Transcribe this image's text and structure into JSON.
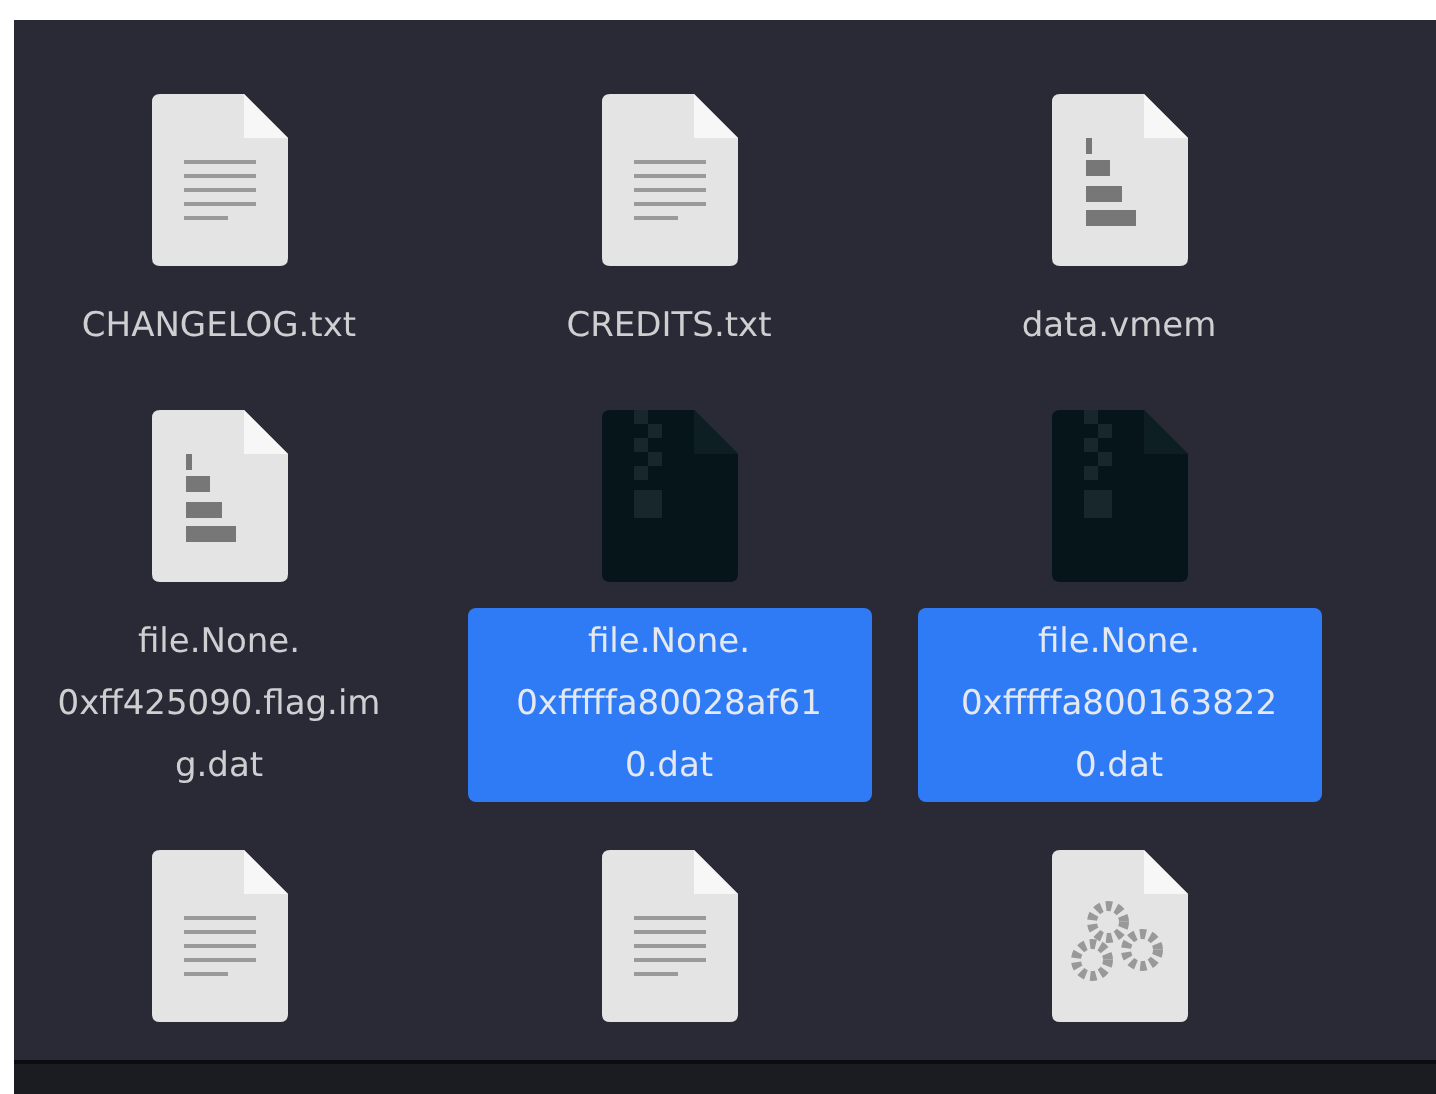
{
  "files": [
    {
      "name": "CHANGELOG.txt",
      "kind": "text",
      "selected": false
    },
    {
      "name": "CREDITS.txt",
      "kind": "text",
      "selected": false
    },
    {
      "name": "data.vmem",
      "kind": "binary",
      "selected": false
    },
    {
      "name": "file.None.\n0xff425090.flag.im\ng.dat",
      "kind": "binary",
      "selected": false
    },
    {
      "name": "file.None.\n0xfffffa80028af61\n0.dat",
      "kind": "archive",
      "selected": true
    },
    {
      "name": "file.None.\n0xfffffa800163822\n0.dat",
      "kind": "archive",
      "selected": true
    },
    {
      "kind": "text"
    },
    {
      "kind": "text"
    },
    {
      "kind": "config"
    }
  ]
}
